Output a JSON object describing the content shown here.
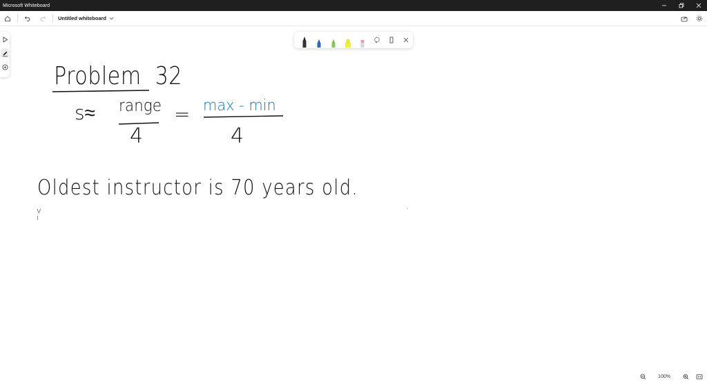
{
  "window": {
    "title": "Microsoft Whiteboard"
  },
  "appbar": {
    "doc_name": "Untitled whiteboard"
  },
  "canvas": {
    "heading": "Problem  32",
    "formula": {
      "lhs": "s≈",
      "numerator1": "range",
      "denominator1": "4",
      "equals": "=",
      "numerator2": "max - min",
      "denominator2": "4"
    },
    "sentence": "Oldest instructor is 70 years old.",
    "stray_mark": "v\ni",
    "dot": "·"
  },
  "zoom": {
    "value": "100%"
  },
  "colors": {
    "titlebar_bg": "#1f1f1f",
    "ink_black": "#111111",
    "ink_blue": "#1a6fb0",
    "pen_black": "#222222",
    "pen_blue": "#1f5fae",
    "pen_green": "#7ab648",
    "pen_yellow": "#e8e436",
    "pen_pink": "#e89aa6"
  },
  "icons": {
    "left_tools": [
      "select-icon",
      "pen-icon",
      "add-icon"
    ],
    "pen_tools": [
      "pen-black-icon",
      "pen-blue-icon",
      "pen-green-icon",
      "highlighter-yellow-icon",
      "eraser-icon",
      "lasso-icon",
      "ruler-icon",
      "close-icon"
    ]
  }
}
